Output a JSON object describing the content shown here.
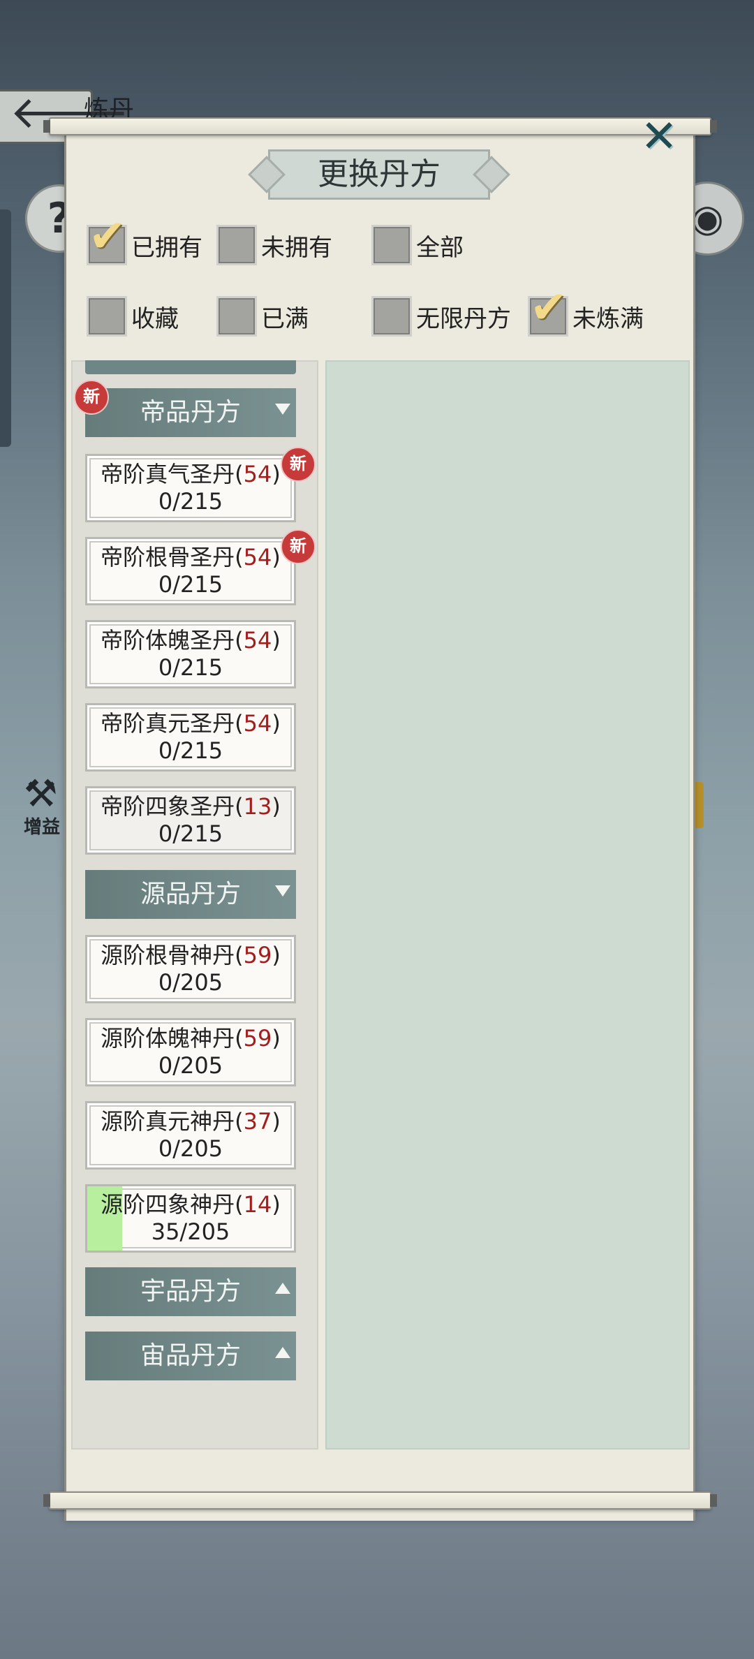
{
  "background": {
    "back_label": "炼丹",
    "side_label": "增益"
  },
  "dialog": {
    "title": "更换丹方",
    "filters": [
      {
        "label": "已拥有",
        "checked": true
      },
      {
        "label": "未拥有",
        "checked": false
      },
      {
        "label": "全部",
        "checked": false
      },
      {
        "label": "收藏",
        "checked": false
      },
      {
        "label": "已满",
        "checked": false
      },
      {
        "label": "无限丹方",
        "checked": false
      },
      {
        "label": "未炼满",
        "checked": true
      }
    ],
    "new_badge": "新",
    "categories": [
      {
        "label": "帝品丹方",
        "expanded": true,
        "items": [
          {
            "name": "帝阶真气圣丹",
            "level": "54",
            "count": "0/215",
            "new": true
          },
          {
            "name": "帝阶根骨圣丹",
            "level": "54",
            "count": "0/215",
            "new": true
          },
          {
            "name": "帝阶体魄圣丹",
            "level": "54",
            "count": "0/215",
            "new": false
          },
          {
            "name": "帝阶真元圣丹",
            "level": "54",
            "count": "0/215",
            "new": false
          },
          {
            "name": "帝阶四象圣丹",
            "level": "13",
            "count": "0/215",
            "new": false
          }
        ]
      },
      {
        "label": "源品丹方",
        "expanded": true,
        "items": [
          {
            "name": "源阶根骨神丹",
            "level": "59",
            "count": "0/205",
            "new": false
          },
          {
            "name": "源阶体魄神丹",
            "level": "59",
            "count": "0/205",
            "new": false
          },
          {
            "name": "源阶真元神丹",
            "level": "37",
            "count": "0/205",
            "new": false
          },
          {
            "name": "源阶四象神丹",
            "level": "14",
            "count": "35/205",
            "new": false,
            "progress": 0.17
          }
        ]
      },
      {
        "label": "宇品丹方",
        "expanded": false,
        "items": []
      },
      {
        "label": "宙品丹方",
        "expanded": false,
        "items": []
      }
    ],
    "colors": {
      "level_text": "#a51c1c",
      "category_header": "#6f8686",
      "detail_panel": "#cddbd0",
      "progress_fill": "#b8ef9e"
    }
  }
}
